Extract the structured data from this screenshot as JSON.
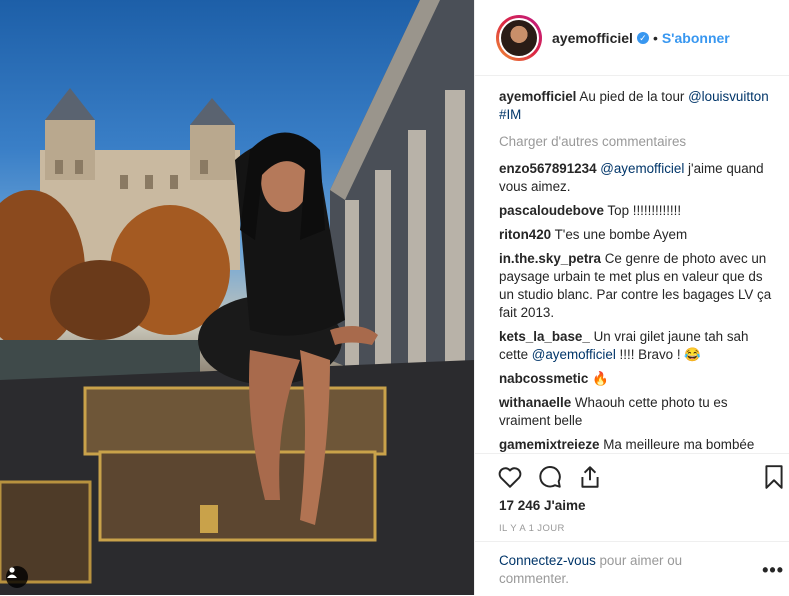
{
  "post": {
    "username": "ayemofficiel",
    "verified_mark": "✓",
    "dot": "•",
    "follow_label": "S'abonner",
    "caption": {
      "user": "ayemofficiel",
      "text": "Au pied de la tour",
      "mention": "@louisvuitton",
      "hashtag": "#IM"
    },
    "load_more": "Charger d'autres commentaires",
    "comments": [
      {
        "user": "enzo567891234",
        "mention": "@ayemofficiel",
        "text": " j'aime quand vous aimez.",
        "after": ""
      },
      {
        "user": "pascaloudebove",
        "mention": "",
        "text": "Top !!!!!!!!!!!!!",
        "after": ""
      },
      {
        "user": "riton420",
        "mention": "",
        "text": "T'es une bombe Ayem",
        "after": ""
      },
      {
        "user": "in.the.sky_petra",
        "mention": "",
        "text": "Ce genre de photo avec un paysage urbain te met plus en valeur que ds un studio blanc. Par contre les bagages LV ça fait 2013.",
        "after": ""
      },
      {
        "user": "kets_la_base_",
        "mention": "",
        "text": "Un vrai gilet jaune tah sah cette ",
        "mention2": "@ayemofficiel",
        "after": " !!!! Bravo ! 😂"
      },
      {
        "user": "nabcossmetic",
        "mention": "",
        "text": "🔥",
        "after": ""
      },
      {
        "user": "withanaelle",
        "mention": "",
        "text": "Whaouh cette photo tu es vraiment belle",
        "after": ""
      },
      {
        "user": "gamemixtreieze",
        "mention": "",
        "text": "Ma meilleure ma bombée",
        "after": ""
      }
    ],
    "likes": "17 246 J'aime",
    "timestamp": "IL Y A 1 JOUR",
    "login_link": "Connectez-vous",
    "login_rest": " pour aimer ou commenter.",
    "more": "•••"
  }
}
